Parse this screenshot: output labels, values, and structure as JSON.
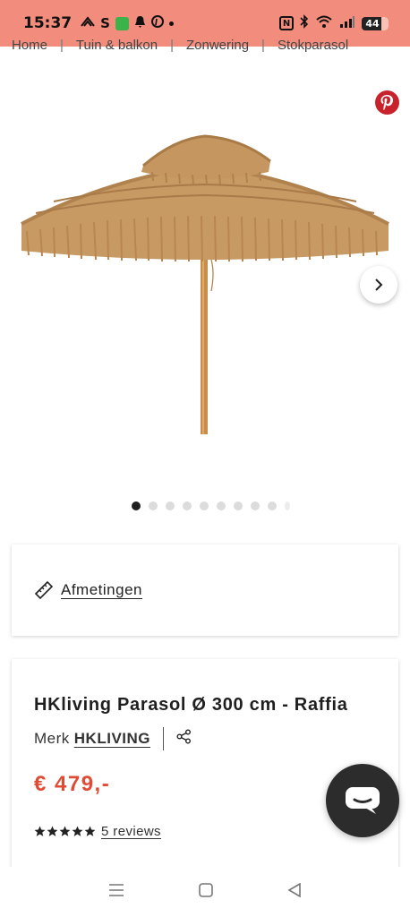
{
  "status_bar": {
    "time": "15:37",
    "s_label": "S",
    "battery": "44"
  },
  "breadcrumb": {
    "items": [
      "Home",
      "Tuin & balkon",
      "Zonwering",
      "Stokparasol"
    ],
    "separator": "|"
  },
  "gallery": {
    "total_images": 10,
    "active_index": 0,
    "image_description_icon": "thatched-parasol"
  },
  "dimensions": {
    "label": "Afmetingen"
  },
  "product": {
    "title": "HKliving Parasol Ø 300 cm - Raffia",
    "brand_prefix": "Merk",
    "brand": "HKLIVING",
    "price": "€ 479,-",
    "rating": 5,
    "reviews_label": "5 reviews"
  },
  "colors": {
    "accent_price": "#e04b35",
    "status_bar": "#f28c7c",
    "pinterest": "#c8232c",
    "chat": "#2c2c2c"
  },
  "icons": [
    "ruler-icon",
    "share-icon",
    "pinterest-icon",
    "chevron-right-icon",
    "chat-icon",
    "star-icon",
    "menu-icon",
    "home-icon",
    "back-icon"
  ]
}
